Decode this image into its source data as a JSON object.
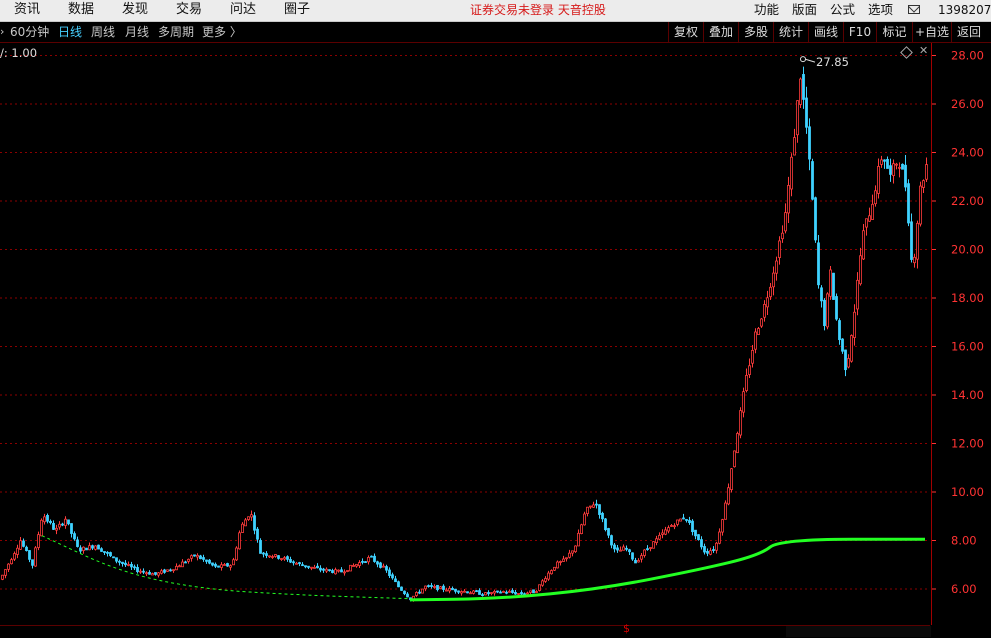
{
  "topbar": {
    "menu": [
      "资讯",
      "数据",
      "发现",
      "交易",
      "问达",
      "圈子"
    ],
    "notice": "证券交易未登录  天音控股",
    "right_menu": [
      "功能",
      "版面",
      "公式",
      "选项"
    ],
    "account": "1398207"
  },
  "toolbar": {
    "periods": [
      "60分钟",
      "日线",
      "周线",
      "月线",
      "多周期",
      "更多 〉"
    ],
    "active_period": "日线",
    "buttons": [
      "复权",
      "叠加",
      "多股",
      "统计",
      "画线",
      "F10",
      "标记",
      "+自选",
      "返回"
    ]
  },
  "chart": {
    "volume_label": "/: 1.00",
    "high_label": "27.85",
    "marker": "$",
    "colors": {
      "up": "#ff3c3c",
      "down": "#3fd2ff",
      "grid": "#8b0000",
      "axis_text": "#ff3333",
      "indicator": "#22ff22"
    }
  },
  "chart_data": {
    "type": "candlestick",
    "y_ticks": [
      "6.00",
      "8.00",
      "10.00",
      "12.00",
      "14.00",
      "16.00",
      "18.00",
      "20.00",
      "22.00",
      "24.00",
      "26.00",
      "28.00"
    ],
    "ylim": [
      5.2,
      28.6
    ],
    "grid": true,
    "annotations": [
      {
        "text": "27.85",
        "value": 27.85
      }
    ],
    "price_path": [
      [
        0,
        6.4
      ],
      [
        10,
        7.2
      ],
      [
        20,
        8.0
      ],
      [
        32,
        7.0
      ],
      [
        42,
        9.1
      ],
      [
        55,
        8.4
      ],
      [
        65,
        8.9
      ],
      [
        78,
        7.6
      ],
      [
        95,
        7.8
      ],
      [
        115,
        7.2
      ],
      [
        135,
        6.8
      ],
      [
        155,
        6.6
      ],
      [
        175,
        6.9
      ],
      [
        195,
        7.4
      ],
      [
        215,
        6.9
      ],
      [
        232,
        7.0
      ],
      [
        240,
        8.5
      ],
      [
        250,
        9.2
      ],
      [
        260,
        7.5
      ],
      [
        280,
        7.3
      ],
      [
        300,
        7.0
      ],
      [
        320,
        6.8
      ],
      [
        340,
        6.7
      ],
      [
        355,
        7.0
      ],
      [
        370,
        7.3
      ],
      [
        385,
        6.8
      ],
      [
        398,
        6.1
      ],
      [
        410,
        5.6
      ],
      [
        425,
        6.1
      ],
      [
        445,
        6.0
      ],
      [
        465,
        5.9
      ],
      [
        485,
        5.8
      ],
      [
        505,
        5.9
      ],
      [
        520,
        5.8
      ],
      [
        535,
        5.9
      ],
      [
        545,
        6.5
      ],
      [
        555,
        7.0
      ],
      [
        565,
        7.2
      ],
      [
        575,
        7.8
      ],
      [
        585,
        9.2
      ],
      [
        595,
        9.6
      ],
      [
        605,
        8.5
      ],
      [
        615,
        7.5
      ],
      [
        625,
        7.7
      ],
      [
        635,
        7.1
      ],
      [
        645,
        7.6
      ],
      [
        658,
        8.1
      ],
      [
        670,
        8.6
      ],
      [
        685,
        9.0
      ],
      [
        695,
        8.2
      ],
      [
        705,
        7.5
      ],
      [
        715,
        7.7
      ],
      [
        725,
        9.5
      ],
      [
        735,
        12.0
      ],
      [
        745,
        14.5
      ],
      [
        755,
        16.5
      ],
      [
        765,
        17.8
      ],
      [
        775,
        19.5
      ],
      [
        785,
        21.5
      ],
      [
        792,
        24.0
      ],
      [
        800,
        27.2
      ],
      [
        806,
        25.0
      ],
      [
        812,
        22.0
      ],
      [
        818,
        18.5
      ],
      [
        824,
        17.0
      ],
      [
        830,
        19.0
      ],
      [
        838,
        16.5
      ],
      [
        846,
        15.0
      ],
      [
        854,
        17.5
      ],
      [
        862,
        20.5
      ],
      [
        872,
        22.0
      ],
      [
        882,
        24.0
      ],
      [
        890,
        23.0
      ],
      [
        898,
        23.8
      ],
      [
        906,
        22.5
      ],
      [
        912,
        19.0
      ],
      [
        920,
        22.5
      ],
      [
        926,
        23.5
      ]
    ],
    "series": [
      {
        "name": "",
        "kind": "arc_dashed",
        "points": [
          [
            42,
            8.2
          ],
          [
            120,
            6.7
          ],
          [
            200,
            6.0
          ],
          [
            300,
            5.75
          ],
          [
            410,
            5.6
          ]
        ]
      },
      {
        "name": "",
        "kind": "arc_solid",
        "points": [
          [
            410,
            5.55
          ],
          [
            500,
            5.6
          ],
          [
            600,
            6.0
          ],
          [
            700,
            6.8
          ],
          [
            760,
            7.4
          ],
          [
            780,
            8.05
          ],
          [
            925,
            8.05
          ]
        ]
      }
    ]
  }
}
